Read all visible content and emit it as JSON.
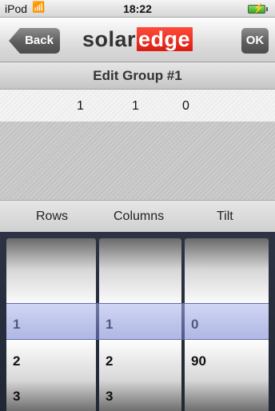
{
  "status_bar": {
    "carrier": "iPod",
    "wifi_icon": "wifi-icon",
    "time": "18:22",
    "battery_icon": "battery-charging-icon"
  },
  "nav": {
    "back_label": "Back",
    "logo_solar": "solar",
    "logo_edge": "edge",
    "ok_label": "OK"
  },
  "title": "Edit Group #1",
  "values": {
    "rows": "1",
    "columns": "1",
    "tilt": "0"
  },
  "headers": {
    "rows": "Rows",
    "columns": "Columns",
    "tilt": "Tilt"
  },
  "picker": {
    "rows": [
      "1",
      "2",
      "3"
    ],
    "columns": [
      "1",
      "2",
      "3"
    ],
    "tilt": [
      "0",
      "90"
    ],
    "selected": {
      "rows": "1",
      "columns": "1",
      "tilt": "0"
    }
  },
  "colors": {
    "brand_red": "#e0261a",
    "selection": "#8c96d8"
  }
}
